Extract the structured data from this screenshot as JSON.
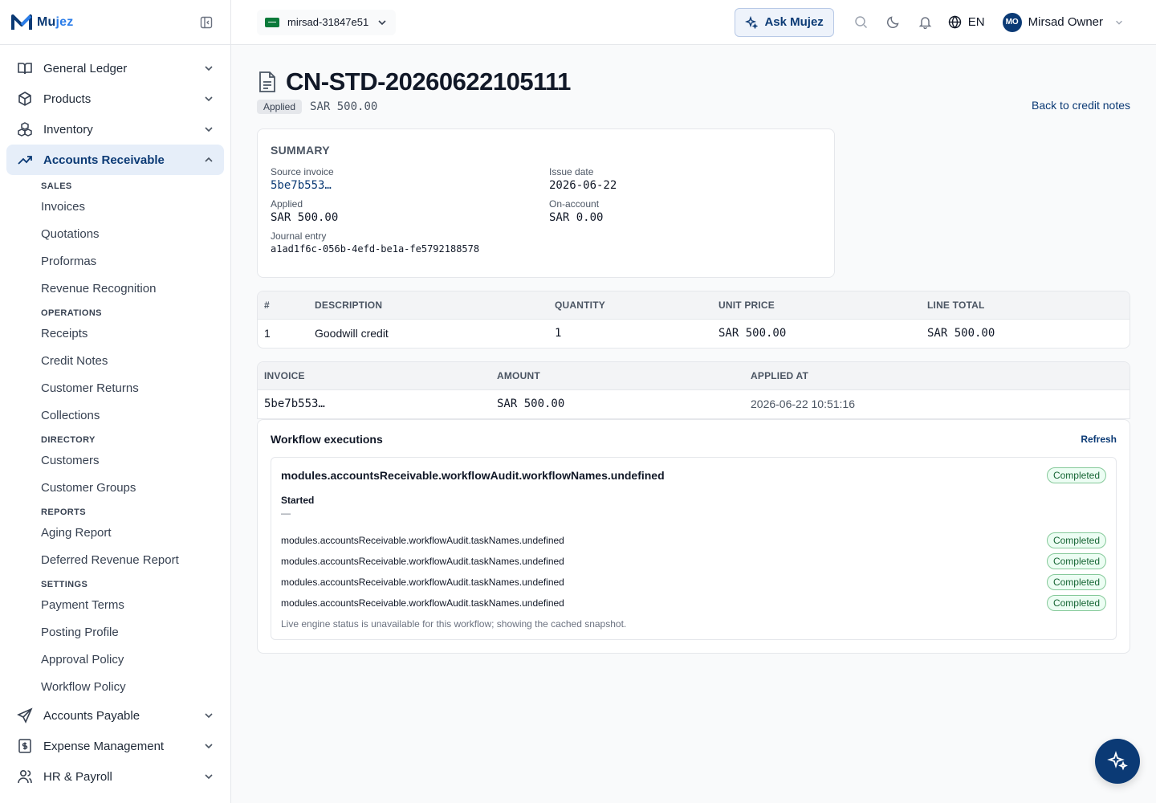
{
  "brand": {
    "name_a": "Mu",
    "name_b": "jez"
  },
  "sidebar": {
    "groups_top": [
      {
        "label": "General Ledger",
        "icon": "book-open-icon"
      },
      {
        "label": "Products",
        "icon": "box-icon"
      },
      {
        "label": "Inventory",
        "icon": "boxes-icon"
      },
      {
        "label": "Accounts Receivable",
        "icon": "trending-up-icon"
      }
    ],
    "sub": {
      "sales": "SALES",
      "invoices": "Invoices",
      "quotations": "Quotations",
      "proformas": "Proformas",
      "revenue_recognition": "Revenue Recognition",
      "operations": "OPERATIONS",
      "receipts": "Receipts",
      "credit_notes": "Credit Notes",
      "customer_returns": "Customer Returns",
      "collections": "Collections",
      "directory": "DIRECTORY",
      "customers": "Customers",
      "customer_groups": "Customer Groups",
      "reports": "REPORTS",
      "aging_report": "Aging Report",
      "deferred_revenue_report": "Deferred Revenue Report",
      "settings": "SETTINGS",
      "payment_terms": "Payment Terms",
      "posting_profile": "Posting Profile",
      "approval_policy": "Approval Policy",
      "workflow_policy": "Workflow Policy"
    },
    "groups_bottom": [
      {
        "label": "Accounts Payable",
        "icon": "send-icon"
      },
      {
        "label": "Expense Management",
        "icon": "dollar-receipt-icon"
      },
      {
        "label": "HR & Payroll",
        "icon": "users-icon"
      }
    ]
  },
  "topbar": {
    "org": "mirsad-31847e51",
    "ask": "Ask Mujez",
    "lang": "EN",
    "user_initials": "MO",
    "user_name": "Mirsad Owner"
  },
  "page": {
    "title": "CN-STD-20260622105111",
    "status": "Applied",
    "amount": "SAR 500.00",
    "back": "Back to credit notes"
  },
  "summary": {
    "heading": "SUMMARY",
    "source_invoice_label": "Source invoice",
    "source_invoice": "5be7b553…",
    "issue_date_label": "Issue date",
    "issue_date": "2026-06-22",
    "applied_label": "Applied",
    "applied": "SAR 500.00",
    "on_account_label": "On-account",
    "on_account": "SAR 0.00",
    "journal_label": "Journal entry",
    "journal": "a1ad1f6c-056b-4efd-be1a-fe5792188578"
  },
  "lines": {
    "headers": [
      "#",
      "DESCRIPTION",
      "QUANTITY",
      "UNIT PRICE",
      "LINE TOTAL"
    ],
    "rows": [
      {
        "n": "1",
        "description": "Goodwill credit",
        "qty": "1",
        "unit_price": "SAR 500.00",
        "total": "SAR 500.00"
      }
    ]
  },
  "applications": {
    "headers": [
      "INVOICE",
      "AMOUNT",
      "APPLIED AT"
    ],
    "rows": [
      {
        "invoice": "5be7b553…",
        "amount": "SAR 500.00",
        "applied_at": "2026-06-22 10:51:16"
      }
    ]
  },
  "workflow": {
    "title": "Workflow executions",
    "refresh": "Refresh",
    "name": "modules.accountsReceivable.workflowAudit.workflowNames.undefined",
    "status": "Completed",
    "started_label": "Started",
    "started_value": "—",
    "tasks": [
      {
        "name": "modules.accountsReceivable.workflowAudit.taskNames.undefined",
        "status": "Completed"
      },
      {
        "name": "modules.accountsReceivable.workflowAudit.taskNames.undefined",
        "status": "Completed"
      },
      {
        "name": "modules.accountsReceivable.workflowAudit.taskNames.undefined",
        "status": "Completed"
      },
      {
        "name": "modules.accountsReceivable.workflowAudit.taskNames.undefined",
        "status": "Completed"
      }
    ],
    "note": "Live engine status is unavailable for this workflow; showing the cached snapshot."
  }
}
